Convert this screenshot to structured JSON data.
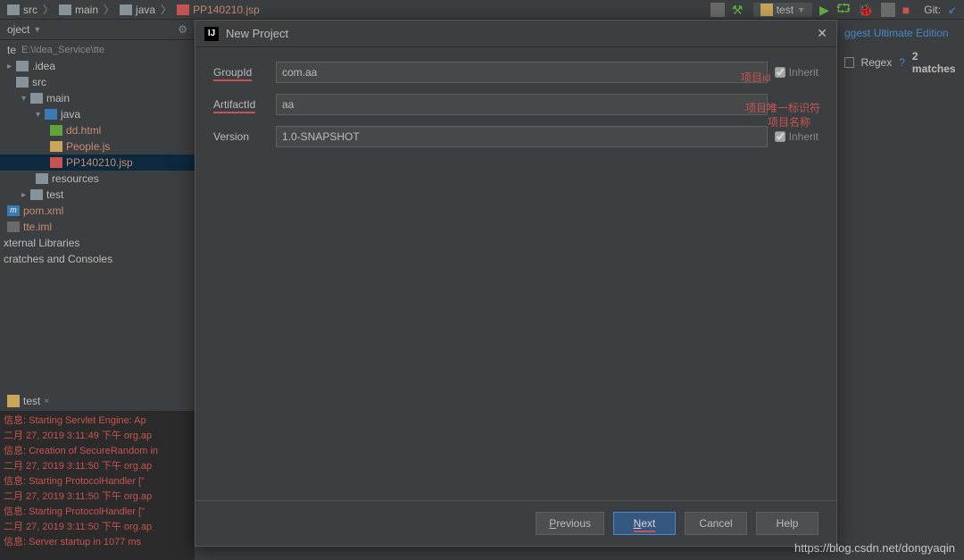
{
  "breadcrumb": {
    "items": [
      "src",
      "main",
      "java",
      "PP140210.jsp"
    ]
  },
  "toolbar": {
    "run_config": "test",
    "git_label": "Git:"
  },
  "project": {
    "header": "oject",
    "root_name": "te",
    "root_path": "E:\\Idea_Service\\tte",
    "items": [
      {
        "label": ".idea"
      },
      {
        "label": "src"
      },
      {
        "label": "main"
      },
      {
        "label": "java"
      },
      {
        "label": "dd.html"
      },
      {
        "label": "People.js"
      },
      {
        "label": "PP140210.jsp"
      },
      {
        "label": "resources"
      },
      {
        "label": "test"
      },
      {
        "label": "pom.xml"
      },
      {
        "label": "tte.iml"
      }
    ],
    "ext_lib": "xternal Libraries",
    "scratches": "cratches and Consoles"
  },
  "right": {
    "edition": "ggest Ultimate Edition",
    "regex": "Regex",
    "help": "?",
    "matches": "2 matches"
  },
  "console": {
    "tab_label": "test",
    "lines": [
      "信息: Starting Servlet Engine: Ap",
      "二月 27, 2019 3:11:49 下午 org.ap",
      "信息: Creation of SecureRandom in",
      "二月 27, 2019 3:11:50 下午 org.ap",
      "信息: Starting ProtocolHandler [\"",
      "二月 27, 2019 3:11:50 下午 org.ap",
      "信息: Starting ProtocolHandler [\"",
      "二月 27, 2019 3:11:50 下午 org.ap",
      "信息: Server startup in 1077 ms"
    ]
  },
  "dialog": {
    "title": "New Project",
    "groupid_label": "GroupId",
    "groupid_value": "com.aa",
    "artifactid_label": "ArtifactId",
    "artifactid_value": "aa",
    "version_label": "Version",
    "version_value": "1.0-SNAPSHOT",
    "inherit_label": "Inherit",
    "buttons": {
      "previous": "Previous",
      "next": "Next",
      "cancel": "Cancel",
      "help": "Help"
    }
  },
  "annotations": {
    "groupid": "项目id",
    "artifactid1": "项目唯一标识符",
    "artifactid2": "项目名称"
  },
  "watermark": "https://blog.csdn.net/dongyaqin"
}
